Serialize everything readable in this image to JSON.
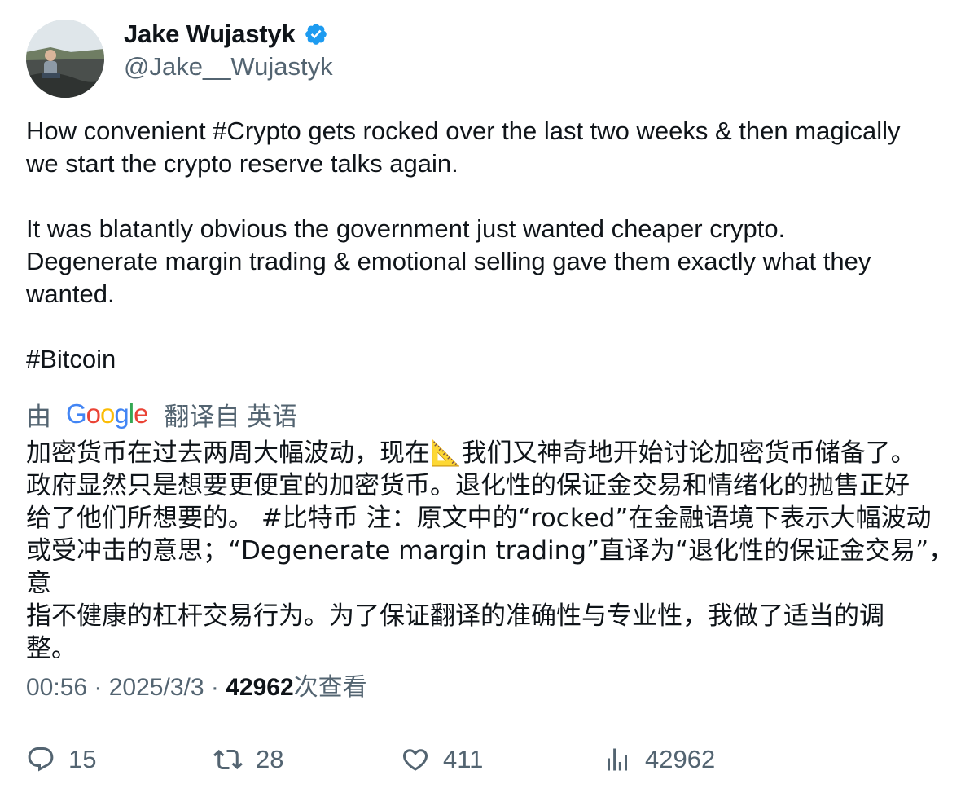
{
  "author": {
    "name": "Jake Wujastyk",
    "handle": "@Jake__Wujastyk",
    "verified_icon": "verified-badge-icon",
    "verified_color": "#1d9bf0"
  },
  "tweet": {
    "text": "How convenient #Crypto gets rocked over the last two weeks & then magically\nwe start the crypto reserve talks again.\n\nIt was blatantly obvious the government just wanted cheaper crypto.\nDegenerate margin trading & emotional selling gave them exactly what they\nwanted.\n\n#Bitcoin"
  },
  "translation": {
    "by_label": "由",
    "provider": "Google",
    "from_label": "翻译自 英语",
    "text": "加密货币在过去两周大幅波动，现在📐我们又神奇地开始讨论加密货币储备了。\n政府显然只是想要更便宜的加密货币。退化性的保证金交易和情绪化的抛售正好\n给了他们所想要的。 #比特币 注：原文中的“rocked”在金融语境下表示大幅波动\n或受冲击的意思；“Degenerate margin trading”直译为“退化性的保证金交易”，意\n指不健康的杠杆交易行为。为了保证翻译的准确性与专业性，我做了适当的调\n整。"
  },
  "meta": {
    "time": "00:56",
    "sep1": " · ",
    "date": "2025/3/3",
    "sep2": " · ",
    "views": "42962",
    "views_label": "次查看"
  },
  "actions": {
    "replies": "15",
    "retweets": "28",
    "likes": "411",
    "views": "42962"
  },
  "colors": {
    "text": "#0f1419",
    "secondary": "#536471"
  }
}
